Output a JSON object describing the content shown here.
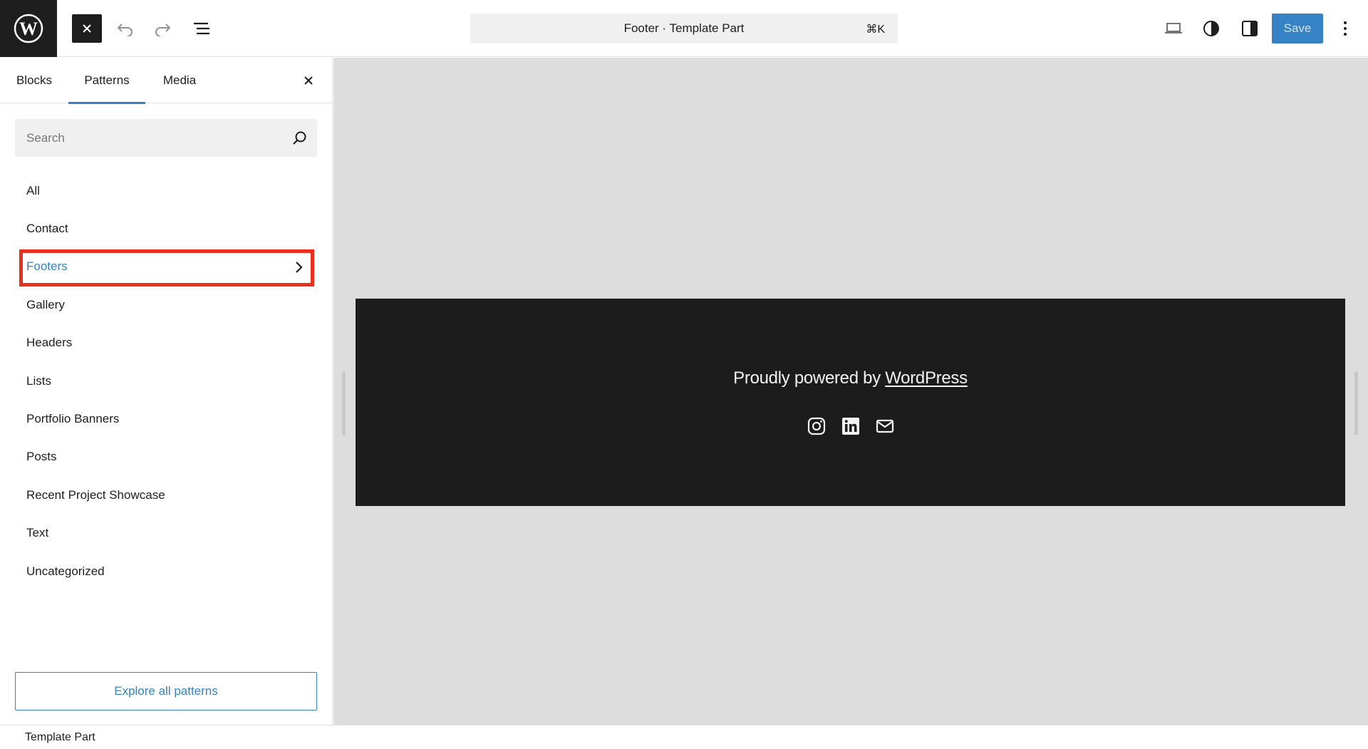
{
  "topbar": {
    "logo_icon": "wordpress-logo-icon",
    "close_icon": "close-icon",
    "undo_icon": "undo-icon",
    "redo_icon": "redo-icon",
    "listview_icon": "list-view-icon",
    "command_title": "Footer · Template Part",
    "command_shortcut": "⌘K",
    "view_icon": "desktop-view-icon",
    "styles_icon": "styles-contrast-icon",
    "settings_icon": "settings-panel-icon",
    "save_label": "Save",
    "options_icon": "more-vertical-icon"
  },
  "sidebar": {
    "tabs": [
      {
        "label": "Blocks",
        "active": false
      },
      {
        "label": "Patterns",
        "active": true
      },
      {
        "label": "Media",
        "active": false
      }
    ],
    "search": {
      "placeholder": "Search",
      "value": ""
    },
    "categories": [
      {
        "label": "All"
      },
      {
        "label": "Contact"
      },
      {
        "label": "Footers",
        "selected": true
      },
      {
        "label": "Gallery"
      },
      {
        "label": "Headers"
      },
      {
        "label": "Lists"
      },
      {
        "label": "Portfolio Banners"
      },
      {
        "label": "Posts"
      },
      {
        "label": "Recent Project Showcase"
      },
      {
        "label": "Text"
      },
      {
        "label": "Uncategorized"
      }
    ],
    "explore_label": "Explore all patterns"
  },
  "canvas": {
    "powered_prefix": "Proudly powered by ",
    "powered_link": "WordPress",
    "social_icons": [
      "instagram-icon",
      "linkedin-icon",
      "mail-icon"
    ]
  },
  "bottombar": {
    "breadcrumb": "Template Part"
  },
  "colors": {
    "accent": "#3582c4",
    "highlight": "#e8301c",
    "footer_bg": "#1c1c1c",
    "canvas_bg": "#dddddd"
  }
}
